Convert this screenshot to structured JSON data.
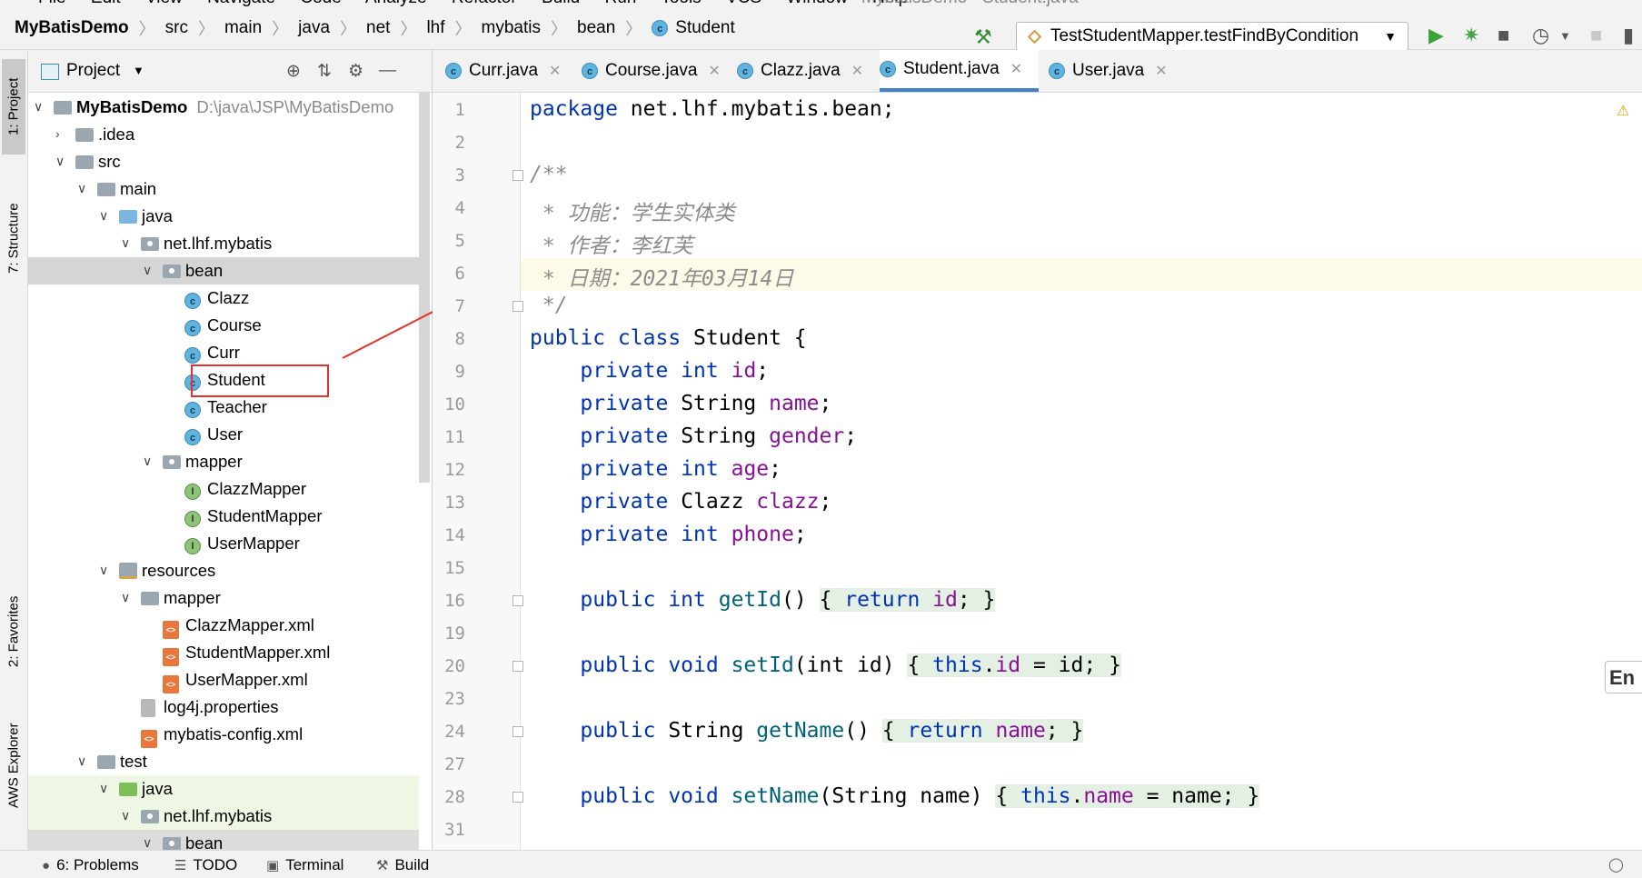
{
  "menu": {
    "items": [
      "File",
      "Edit",
      "View",
      "Navigate",
      "Code",
      "Analyze",
      "Refactor",
      "Build",
      "Run",
      "Tools",
      "VCS",
      "Window",
      "Help"
    ],
    "window_title": "MybatisDemo - Student.java"
  },
  "breadcrumb": [
    "MyBatisDemo",
    "src",
    "main",
    "java",
    "net",
    "lhf",
    "mybatis",
    "bean",
    "Student"
  ],
  "run_config": "TestStudentMapper.testFindByCondition",
  "left_stripe": {
    "project": "1: Project",
    "structure": "7: Structure",
    "favorites": "2: Favorites",
    "aws": "AWS Explorer"
  },
  "project_panel": {
    "title": "Project",
    "tree": [
      {
        "label": "MyBatisDemo",
        "path": "D:\\java\\JSP\\MyBatisDemo"
      },
      {
        "label": ".idea"
      },
      {
        "label": "src"
      },
      {
        "label": "main"
      },
      {
        "label": "java"
      },
      {
        "label": "net.lhf.mybatis"
      },
      {
        "label": "bean"
      },
      {
        "label": "Clazz"
      },
      {
        "label": "Course"
      },
      {
        "label": "Curr"
      },
      {
        "label": "Student"
      },
      {
        "label": "Teacher"
      },
      {
        "label": "User"
      },
      {
        "label": "mapper"
      },
      {
        "label": "ClazzMapper"
      },
      {
        "label": "StudentMapper"
      },
      {
        "label": "UserMapper"
      },
      {
        "label": "resources"
      },
      {
        "label": "mapper"
      },
      {
        "label": "ClazzMapper.xml"
      },
      {
        "label": "StudentMapper.xml"
      },
      {
        "label": "UserMapper.xml"
      },
      {
        "label": "log4j.properties"
      },
      {
        "label": "mybatis-config.xml"
      },
      {
        "label": "test"
      },
      {
        "label": "java"
      },
      {
        "label": "net.lhf.mybatis"
      },
      {
        "label": "bean"
      }
    ]
  },
  "tabs": [
    {
      "label": "Curr.java"
    },
    {
      "label": "Course.java"
    },
    {
      "label": "Clazz.java"
    },
    {
      "label": "Student.java"
    },
    {
      "label": "User.java"
    }
  ],
  "line_numbers": [
    "1",
    "2",
    "3",
    "4",
    "5",
    "6",
    "7",
    "8",
    "9",
    "10",
    "11",
    "12",
    "13",
    "14",
    "15",
    "16",
    "19",
    "20",
    "23",
    "24",
    "27",
    "28",
    "31"
  ],
  "code": {
    "l1": [
      "package",
      "net.lhf.mybatis.bean;"
    ],
    "l3": "/**",
    "l4": " * 功能：学生实体类",
    "l5": " * 作者：李红芙",
    "l6": " * 日期：2021年03月14日",
    "l7": " */",
    "l8": [
      "public class",
      "Student {"
    ],
    "fields": [
      {
        "mod": "private",
        "type": "int",
        "name": "id"
      },
      {
        "mod": "private",
        "type": "String",
        "name": "name"
      },
      {
        "mod": "private",
        "type": "String",
        "name": "gender"
      },
      {
        "mod": "private",
        "type": "int",
        "name": "age"
      },
      {
        "mod": "private",
        "type": "Clazz",
        "name": "clazz"
      },
      {
        "mod": "private",
        "type": "int",
        "name": "phone"
      }
    ],
    "l16": {
      "mod": "public int",
      "method": "getId",
      "body_kw": "return",
      "body_field": "id"
    },
    "l20": {
      "mod": "public void",
      "method": "setId",
      "param": "(int id)",
      "this": "this",
      "field": "id",
      "rest": " = id;"
    },
    "l24": {
      "mod": "public",
      "type": "String",
      "method": "getName",
      "body_kw": "return",
      "body_field": "name"
    },
    "l28": {
      "mod": "public void",
      "method": "setName",
      "param": "(String name)",
      "this": "this",
      "field": "name",
      "rest": " = name;"
    }
  },
  "ime": "En",
  "bottom_bar": [
    "6: Problems",
    "TODO",
    "Terminal",
    "Build"
  ],
  "colors": {
    "keyword": "#0033b3",
    "field": "#871094",
    "method": "#00627a",
    "comment": "#8c8c8c",
    "annotation": "#e8312a"
  }
}
